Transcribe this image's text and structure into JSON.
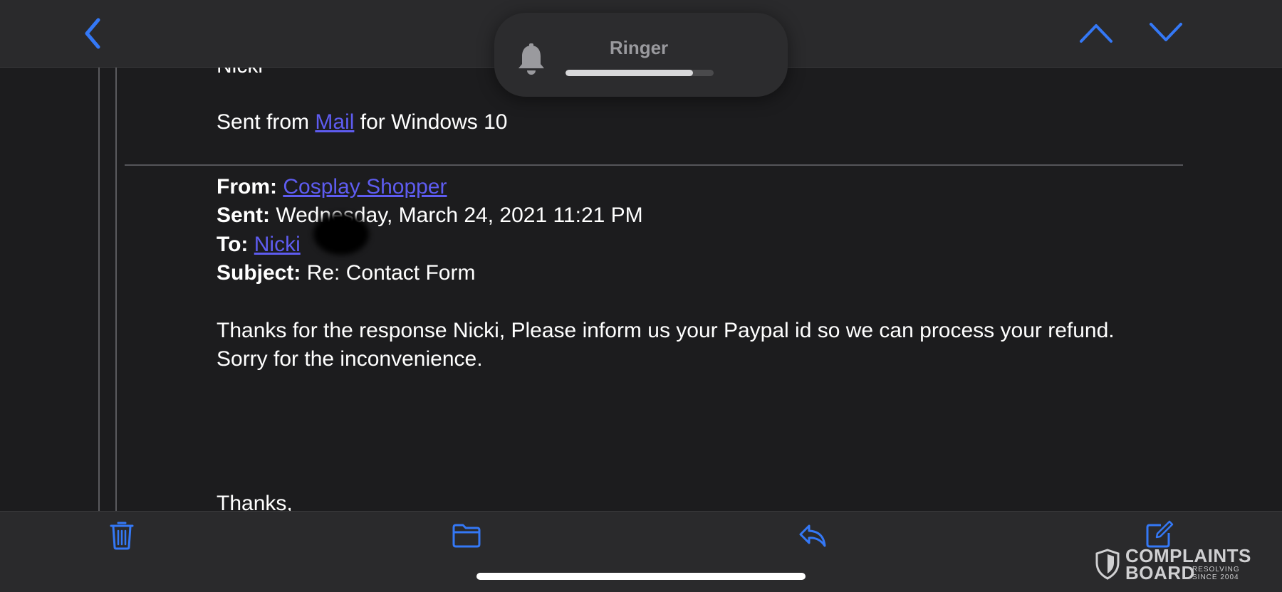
{
  "topbar": {
    "back_icon": "chevron-left-icon",
    "prev_icon": "chevron-up-icon",
    "next_icon": "chevron-down-icon",
    "accent_color": "#3478f6"
  },
  "ringer": {
    "label": "Ringer",
    "icon": "bell-icon",
    "level": 0.86
  },
  "email": {
    "signature_name": "Nicki",
    "sent_from_prefix": "Sent from ",
    "sent_from_link": "Mail",
    "sent_from_suffix": " for Windows 10",
    "header": {
      "from_label": "From:",
      "from_value": "Cosplay Shopper",
      "sent_label": "Sent:",
      "sent_value": "Wednesday, March 24, 2021 11:21 PM",
      "to_label": "To:",
      "to_value": "Nicki",
      "subject_label": "Subject:",
      "subject_value": "Re: Contact Form"
    },
    "body_line1": "Thanks for the response Nicki, Please inform us your Paypal id so we can process your refund.",
    "body_line2": "Sorry for the inconvenience.",
    "closing": "Thanks,"
  },
  "toolbar": {
    "trash_icon": "trash-icon",
    "folder_icon": "folder-icon",
    "reply_icon": "reply-icon",
    "compose_icon": "compose-icon"
  },
  "watermark": {
    "line1": "COMPLAINTS",
    "line2": "BOARD",
    "sub1": "RESOLVING",
    "sub2": "SINCE 2004"
  },
  "colors": {
    "background": "#1c1c1e",
    "bar": "#2a2a2c",
    "link": "#5e5cf0",
    "icon_accent": "#3478f6"
  }
}
